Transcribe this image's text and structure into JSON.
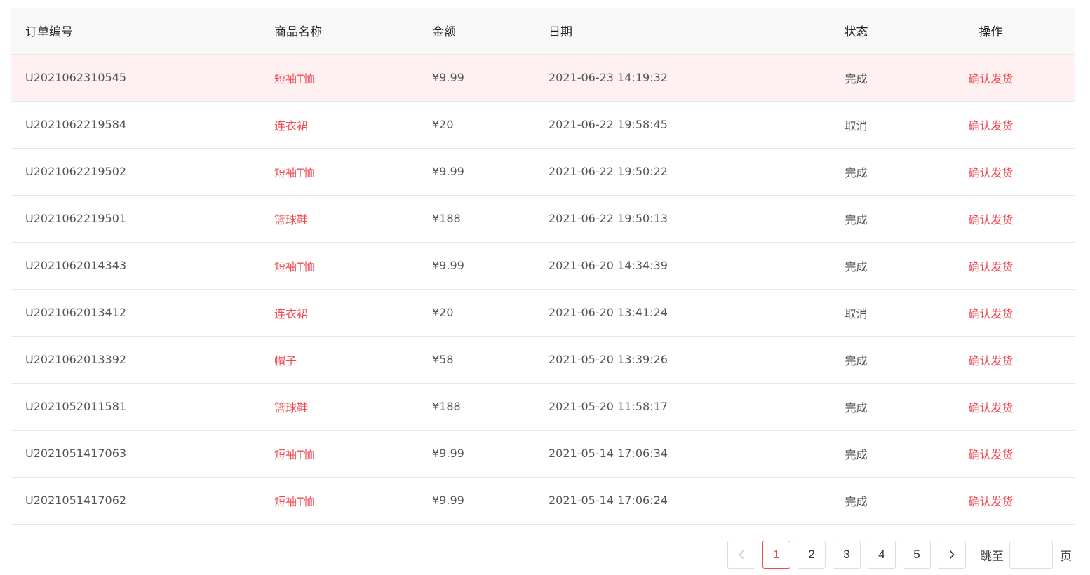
{
  "table": {
    "headers": {
      "order_no": "订单编号",
      "product": "商品名称",
      "amount": "金额",
      "date": "日期",
      "status": "状态",
      "action": "操作"
    },
    "rows": [
      {
        "order_no": "U2021062310545",
        "product": "短袖T恤",
        "amount": "¥9.99",
        "date": "2021-06-23 14:19:32",
        "status": "完成",
        "action": "确认发货"
      },
      {
        "order_no": "U2021062219584",
        "product": "连衣裙",
        "amount": "¥20",
        "date": "2021-06-22 19:58:45",
        "status": "取消",
        "action": "确认发货"
      },
      {
        "order_no": "U2021062219502",
        "product": "短袖T恤",
        "amount": "¥9.99",
        "date": "2021-06-22 19:50:22",
        "status": "完成",
        "action": "确认发货"
      },
      {
        "order_no": "U2021062219501",
        "product": "篮球鞋",
        "amount": "¥188",
        "date": "2021-06-22 19:50:13",
        "status": "完成",
        "action": "确认发货"
      },
      {
        "order_no": "U2021062014343",
        "product": "短袖T恤",
        "amount": "¥9.99",
        "date": "2021-06-20 14:34:39",
        "status": "完成",
        "action": "确认发货"
      },
      {
        "order_no": "U2021062013412",
        "product": "连衣裙",
        "amount": "¥20",
        "date": "2021-06-20 13:41:24",
        "status": "取消",
        "action": "确认发货"
      },
      {
        "order_no": "U2021062013392",
        "product": "帽子",
        "amount": "¥58",
        "date": "2021-05-20 13:39:26",
        "status": "完成",
        "action": "确认发货"
      },
      {
        "order_no": "U2021052011581",
        "product": "篮球鞋",
        "amount": "¥188",
        "date": "2021-05-20 11:58:17",
        "status": "完成",
        "action": "确认发货"
      },
      {
        "order_no": "U2021051417063",
        "product": "短袖T恤",
        "amount": "¥9.99",
        "date": "2021-05-14 17:06:34",
        "status": "完成",
        "action": "确认发货"
      },
      {
        "order_no": "U2021051417062",
        "product": "短袖T恤",
        "amount": "¥9.99",
        "date": "2021-05-14 17:06:24",
        "status": "完成",
        "action": "确认发货"
      }
    ]
  },
  "pagination": {
    "prev_icon": "chevron-left-icon",
    "next_icon": "chevron-right-icon",
    "pages": [
      "1",
      "2",
      "3",
      "4",
      "5"
    ],
    "current": "1",
    "jump_label": "跳至",
    "jump_value": "",
    "page_unit": "页"
  },
  "colors": {
    "accent": "#ee4d55",
    "highlight_row": "#fff1f1",
    "header_bg": "#f8f8f8"
  }
}
